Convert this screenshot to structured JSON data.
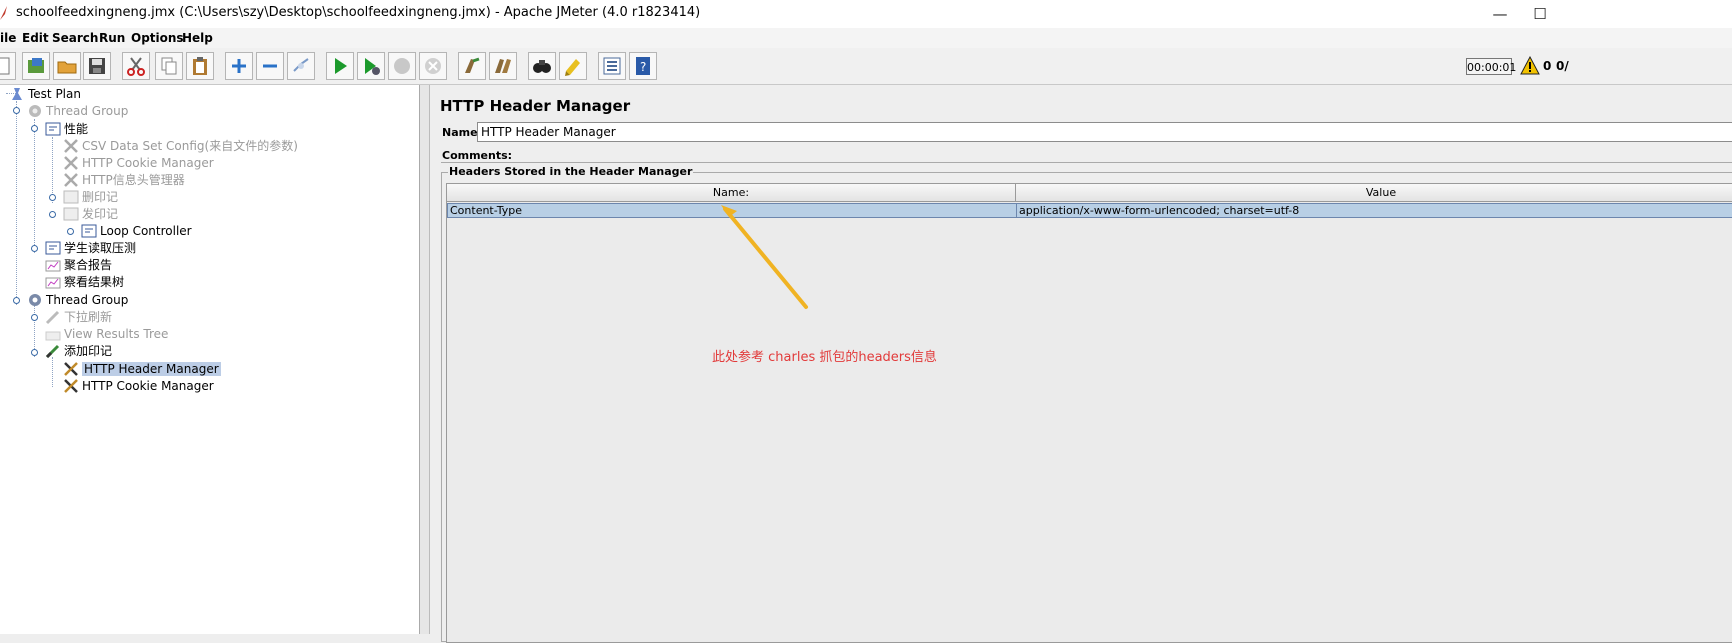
{
  "window": {
    "title": "schoolfeedxingneng.jmx (C:\\Users\\szy\\Desktop\\schoolfeedxingneng.jmx) - Apache JMeter (4.0 r1823414)",
    "minimize": "—",
    "maximize": "☐"
  },
  "menu": [
    "ile",
    "Edit",
    "Search",
    "Run",
    "Options",
    "Help"
  ],
  "toolbar": {
    "timer": "00:00:01",
    "warning_count": "0",
    "threads": "0/"
  },
  "tree": [
    {
      "label": "Test Plan",
      "icon": "test-plan-icon",
      "disabled": false
    },
    {
      "label": "Thread Group",
      "icon": "thread-group-icon",
      "disabled": true
    },
    {
      "label": "性能",
      "icon": "controller-icon",
      "disabled": false
    },
    {
      "label": "CSV Data Set Config(来自文件的参数)",
      "icon": "config-element-icon",
      "disabled": true
    },
    {
      "label": "HTTP Cookie Manager",
      "icon": "config-element-icon",
      "disabled": true
    },
    {
      "label": "HTTP信息头管理器",
      "icon": "config-element-icon",
      "disabled": true
    },
    {
      "label": "删印记",
      "icon": "controller-icon",
      "disabled": true
    },
    {
      "label": "发印记",
      "icon": "controller-icon",
      "disabled": true
    },
    {
      "label": "Loop Controller",
      "icon": "controller-icon",
      "disabled": false
    },
    {
      "label": "学生读取压测",
      "icon": "controller-icon",
      "disabled": false
    },
    {
      "label": "聚合报告",
      "icon": "listener-icon",
      "disabled": false
    },
    {
      "label": "察看结果树",
      "icon": "listener-icon",
      "disabled": false
    },
    {
      "label": "Thread Group",
      "icon": "thread-group-icon",
      "disabled": false
    },
    {
      "label": "下拉刷新",
      "icon": "sampler-icon",
      "disabled": true
    },
    {
      "label": "View Results Tree",
      "icon": "listener-icon",
      "disabled": true
    },
    {
      "label": "添加印记",
      "icon": "sampler-icon",
      "disabled": false
    },
    {
      "label": "HTTP Header Manager",
      "icon": "config-element-icon",
      "disabled": false,
      "selected": true
    },
    {
      "label": "HTTP Cookie Manager",
      "icon": "config-element-icon",
      "disabled": false
    }
  ],
  "panel": {
    "title": "HTTP Header Manager",
    "name_label": "Name:",
    "name_value": "HTTP Header Manager",
    "comments_label": "Comments:",
    "headers_legend": "Headers Stored in the Header Manager",
    "columns": [
      "Name:",
      "Value"
    ],
    "rows": [
      {
        "name": "Content-Type",
        "value": "application/x-www-form-urlencoded; charset=utf-8"
      }
    ]
  },
  "annotation": "此处参考 charles 抓包的headers信息"
}
